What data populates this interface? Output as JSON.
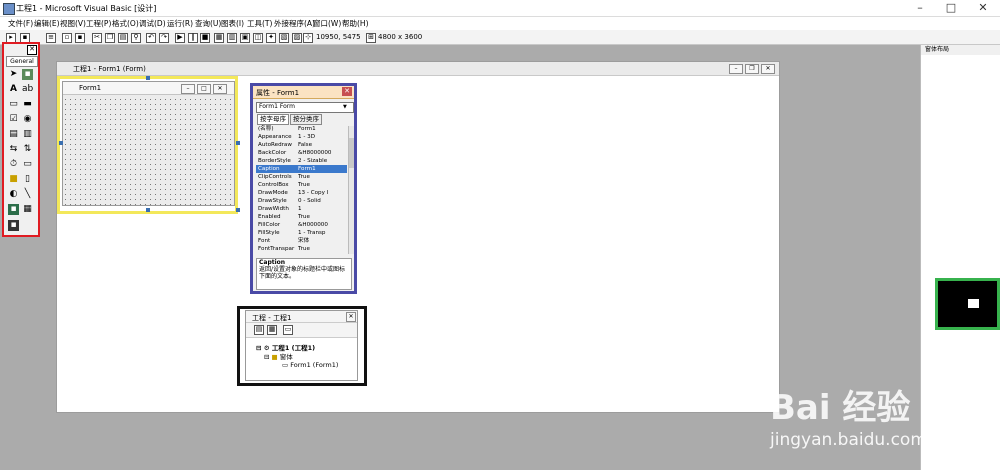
{
  "window": {
    "title": "工程1 - Microsoft Visual Basic [设计]"
  },
  "menu": [
    "文件(F)",
    "编辑(E)",
    "视图(V)",
    "工程(P)",
    "格式(O)",
    "调试(D)",
    "运行(R)",
    "查询(U)",
    "图表(I)",
    "工具(T)",
    "外接程序(A)",
    "窗口(W)",
    "帮助(H)"
  ],
  "toolbar": {
    "position": "10950, 5475",
    "size": "4800 x 3600"
  },
  "toolbox": {
    "tab": "General"
  },
  "project_window": {
    "title": "工程1 - Form1 (Form)"
  },
  "form_designer": {
    "title": "Form1"
  },
  "properties": {
    "title": "属性 - Form1",
    "object": "Form1 Form",
    "tabs": [
      "按字母序",
      "按分类序"
    ],
    "rows": [
      {
        "name": "(名称)",
        "value": "Form1"
      },
      {
        "name": "Appearance",
        "value": "1 - 3D"
      },
      {
        "name": "AutoRedraw",
        "value": "False"
      },
      {
        "name": "BackColor",
        "value": "&H8000000"
      },
      {
        "name": "BorderStyle",
        "value": "2 - Sizable"
      },
      {
        "name": "Caption",
        "value": "Form1"
      },
      {
        "name": "ClipControls",
        "value": "True"
      },
      {
        "name": "ControlBox",
        "value": "True"
      },
      {
        "name": "DrawMode",
        "value": "13 - Copy I"
      },
      {
        "name": "DrawStyle",
        "value": "0 - Solid"
      },
      {
        "name": "DrawWidth",
        "value": "1"
      },
      {
        "name": "Enabled",
        "value": "True"
      },
      {
        "name": "FillColor",
        "value": "&H000000"
      },
      {
        "name": "FillStyle",
        "value": "1 - Transp"
      },
      {
        "name": "Font",
        "value": "宋体"
      },
      {
        "name": "FontTranspar",
        "value": "True"
      }
    ],
    "highlighted_index": 5,
    "desc_title": "Caption",
    "desc_text": "返回/设置对象的标题栏中或图标下面的文本。"
  },
  "project_explorer": {
    "title": "工程 - 工程1",
    "root": "工程1 (工程1)",
    "folder": "窗体",
    "item": "Form1 (Form1)"
  },
  "layout_panel": {
    "title": "窗体布局"
  },
  "watermark": {
    "logo": "Bai 经验",
    "url": "jingyan.baidu.com"
  }
}
